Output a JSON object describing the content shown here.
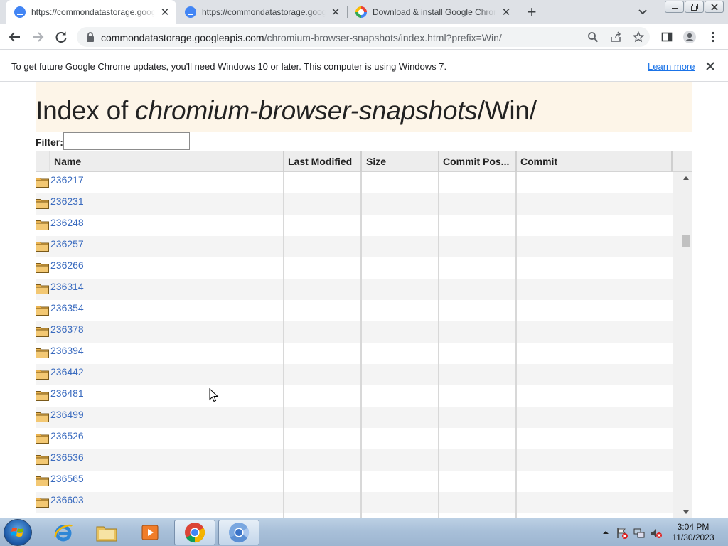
{
  "browser": {
    "tabs": [
      {
        "title": "https://commondatastorage.googleapis.com",
        "active": true
      },
      {
        "title": "https://commondatastorage.googleapis.com",
        "active": false
      },
      {
        "title": "Download & install Google Chrome",
        "active": false
      }
    ],
    "address": {
      "host": "commondatastorage.googleapis.com",
      "path": "/chromium-browser-snapshots/index.html?prefix=Win/"
    }
  },
  "infobar": {
    "message": "To get future Google Chrome updates, you'll need Windows 10 or later. This computer is using Windows 7.",
    "link": "Learn more"
  },
  "page": {
    "title_prefix": "Index of ",
    "title_bucket": "chromium-browser-snapshots",
    "title_suffix": "/Win/",
    "filter_label": "Filter:",
    "filter_value": "",
    "columns": [
      "Name",
      "Last Modified",
      "Size",
      "Commit Pos...",
      "Commit"
    ],
    "rows": [
      "236217",
      "236231",
      "236248",
      "236257",
      "236266",
      "236314",
      "236354",
      "236378",
      "236394",
      "236442",
      "236481",
      "236499",
      "236526",
      "236536",
      "236565",
      "236603"
    ]
  },
  "taskbar": {
    "time": "3:04 PM",
    "date": "11/30/2023"
  },
  "colors": {
    "link": "#3a6bbf",
    "header_band": "#fdf5e8",
    "accent": "#1a73e8"
  }
}
